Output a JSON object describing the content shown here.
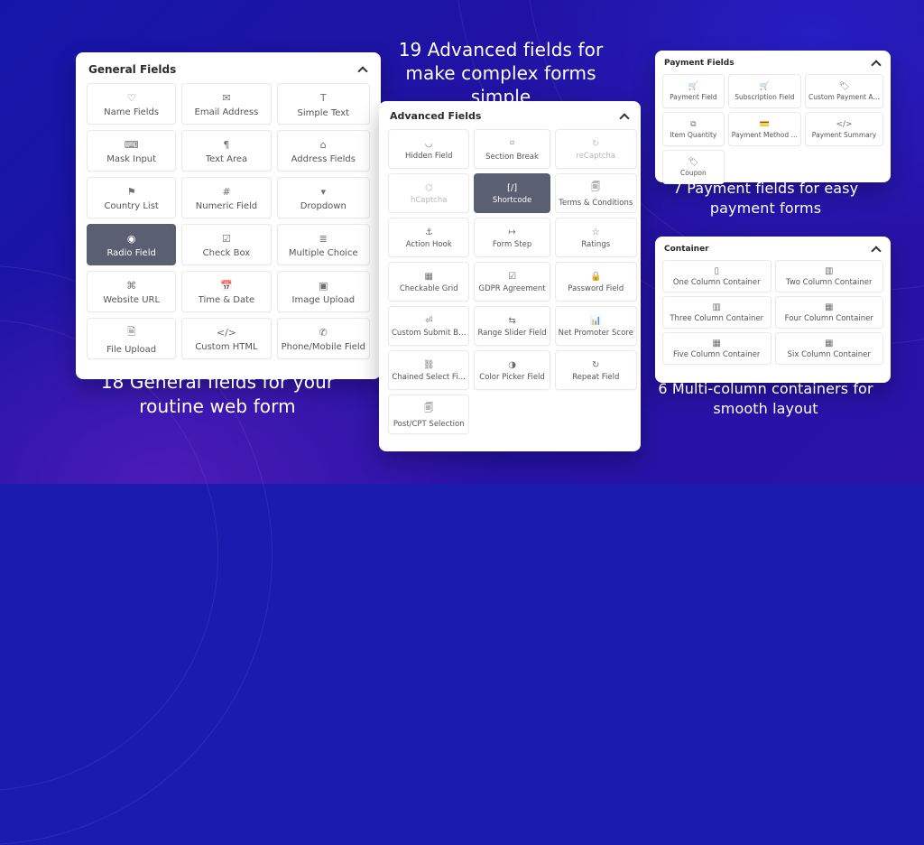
{
  "captions": {
    "general": "18 General fields for your routine web form",
    "advanced": "19 Advanced fields for make complex forms simple",
    "payment": "7 Payment fields for easy payment forms",
    "container": "6 Multi-column containers for smooth layout"
  },
  "panels": {
    "general": {
      "title": "General Fields",
      "items": [
        {
          "label": "Name Fields",
          "icon": "user-icon",
          "glyph": "♡"
        },
        {
          "label": "Email Address",
          "icon": "email-icon",
          "glyph": "✉"
        },
        {
          "label": "Simple Text",
          "icon": "text-icon",
          "glyph": "Ｔ"
        },
        {
          "label": "Mask Input",
          "icon": "mask-icon",
          "glyph": "⌨"
        },
        {
          "label": "Text Area",
          "icon": "textarea-icon",
          "glyph": "¶"
        },
        {
          "label": "Address Fields",
          "icon": "address-icon",
          "glyph": "⌂"
        },
        {
          "label": "Country List",
          "icon": "flag-icon",
          "glyph": "⚑"
        },
        {
          "label": "Numeric Field",
          "icon": "number-icon",
          "glyph": "#"
        },
        {
          "label": "Dropdown",
          "icon": "dropdown-icon",
          "glyph": "▾"
        },
        {
          "label": "Radio Field",
          "icon": "radio-icon",
          "glyph": "◉",
          "selected": true
        },
        {
          "label": "Check Box",
          "icon": "checkbox-icon",
          "glyph": "☑"
        },
        {
          "label": "Multiple Choice",
          "icon": "multiple-choice-icon",
          "glyph": "≣"
        },
        {
          "label": "Website URL",
          "icon": "link-icon",
          "glyph": "⌘"
        },
        {
          "label": "Time & Date",
          "icon": "calendar-icon",
          "glyph": "📅"
        },
        {
          "label": "Image Upload",
          "icon": "image-icon",
          "glyph": "▣"
        },
        {
          "label": "File Upload",
          "icon": "file-icon",
          "glyph": "🗎"
        },
        {
          "label": "Custom HTML",
          "icon": "html-icon",
          "glyph": "</>"
        },
        {
          "label": "Phone/Mobile Field",
          "icon": "phone-icon",
          "glyph": "✆"
        }
      ]
    },
    "advanced": {
      "title": "Advanced Fields",
      "items": [
        {
          "label": "Hidden Field",
          "icon": "hidden-icon",
          "glyph": "◡"
        },
        {
          "label": "Section Break",
          "icon": "section-icon",
          "glyph": "⸋"
        },
        {
          "label": "reCaptcha",
          "icon": "recaptcha-icon",
          "glyph": "↻",
          "muted": true
        },
        {
          "label": "hCaptcha",
          "icon": "hcaptcha-icon",
          "glyph": "⌬",
          "muted": true
        },
        {
          "label": "Shortcode",
          "icon": "shortcode-icon",
          "glyph": "[/]",
          "selected": true
        },
        {
          "label": "Terms & Conditions",
          "icon": "terms-icon",
          "glyph": "🗐"
        },
        {
          "label": "Action Hook",
          "icon": "hook-icon",
          "glyph": "⚓"
        },
        {
          "label": "Form Step",
          "icon": "step-icon",
          "glyph": "↦"
        },
        {
          "label": "Ratings",
          "icon": "star-icon",
          "glyph": "☆"
        },
        {
          "label": "Checkable Grid",
          "icon": "grid-icon",
          "glyph": "▦"
        },
        {
          "label": "GDPR Agreement",
          "icon": "gdpr-icon",
          "glyph": "☑"
        },
        {
          "label": "Password Field",
          "icon": "password-icon",
          "glyph": "🔒"
        },
        {
          "label": "Custom Submit B…",
          "icon": "submit-icon",
          "glyph": "⏎"
        },
        {
          "label": "Range Slider Field",
          "icon": "slider-icon",
          "glyph": "⇆"
        },
        {
          "label": "Net Promoter Score",
          "icon": "nps-icon",
          "glyph": "📊"
        },
        {
          "label": "Chained Select Fi…",
          "icon": "chain-icon",
          "glyph": "⛓"
        },
        {
          "label": "Color Picker Field",
          "icon": "color-icon",
          "glyph": "◑"
        },
        {
          "label": "Repeat Field",
          "icon": "repeat-icon",
          "glyph": "↻"
        },
        {
          "label": "Post/CPT Selection",
          "icon": "post-icon",
          "glyph": "🗐"
        }
      ]
    },
    "payment": {
      "title": "Payment Fields",
      "items": [
        {
          "label": "Payment Field",
          "icon": "payment-icon",
          "glyph": "🛒"
        },
        {
          "label": "Subscription Field",
          "icon": "subscription-icon",
          "glyph": "🛒"
        },
        {
          "label": "Custom Payment A…",
          "icon": "custom-payment-icon",
          "glyph": "🏷"
        },
        {
          "label": "Item Quantity",
          "icon": "quantity-icon",
          "glyph": "⧉"
        },
        {
          "label": "Payment Method …",
          "icon": "method-icon",
          "glyph": "💳"
        },
        {
          "label": "Payment Summary",
          "icon": "summary-icon",
          "glyph": "</>"
        },
        {
          "label": "Coupon",
          "icon": "coupon-icon",
          "glyph": "🏷"
        }
      ]
    },
    "container": {
      "title": "Container",
      "items": [
        {
          "label": "One Column Container",
          "icon": "one-col-icon",
          "glyph": "▯"
        },
        {
          "label": "Two Column Container",
          "icon": "two-col-icon",
          "glyph": "▥"
        },
        {
          "label": "Three Column Container",
          "icon": "three-col-icon",
          "glyph": "▥"
        },
        {
          "label": "Four Column Container",
          "icon": "four-col-icon",
          "glyph": "▦"
        },
        {
          "label": "Five Column Container",
          "icon": "five-col-icon",
          "glyph": "▦"
        },
        {
          "label": "Six Column Container",
          "icon": "six-col-icon",
          "glyph": "▦"
        }
      ]
    }
  }
}
